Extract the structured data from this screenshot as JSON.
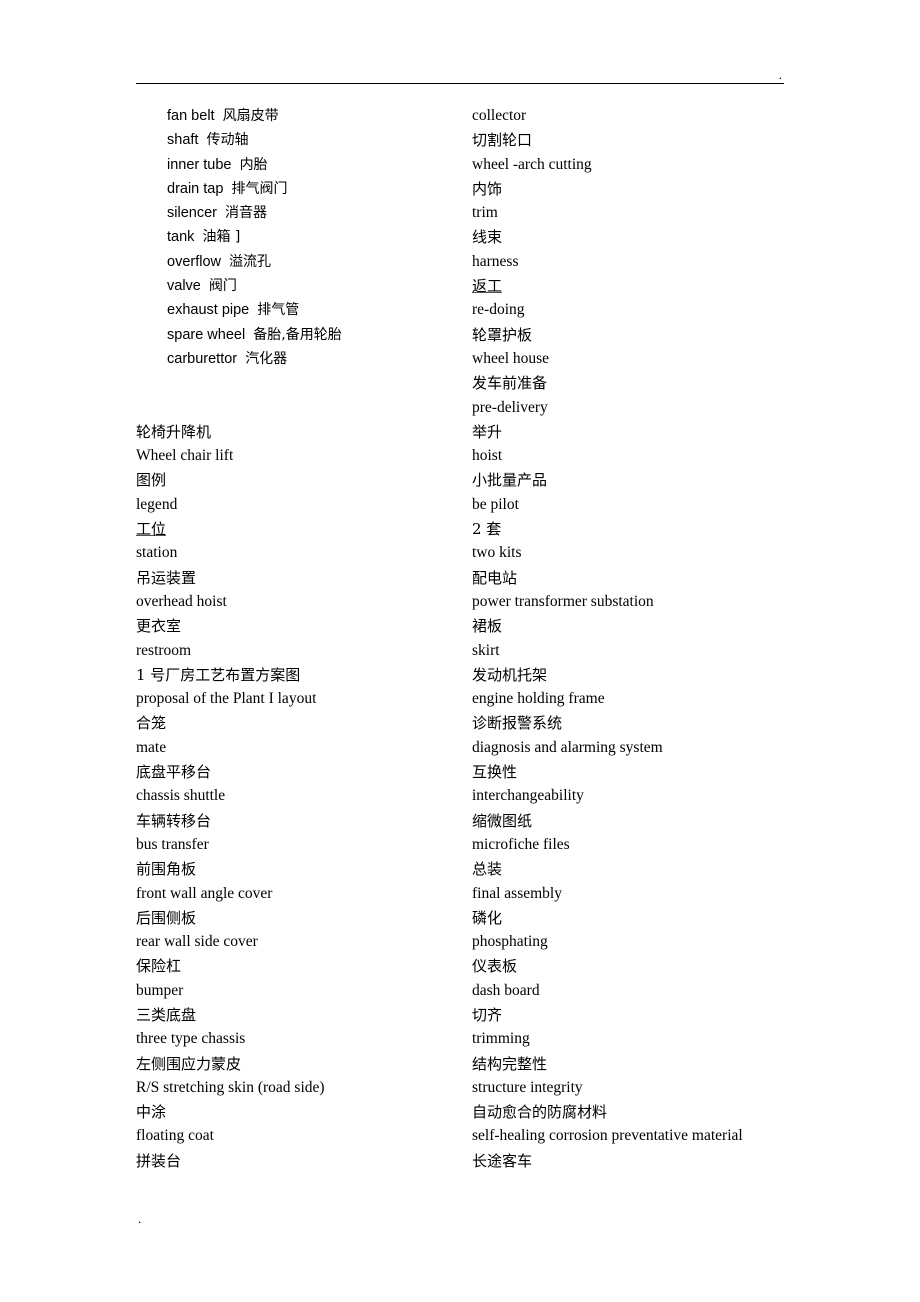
{
  "document": {
    "title": "Chinese-English Automotive Manufacturing Glossary",
    "header_rule_mark": ".",
    "footer_mark": "."
  },
  "left_column": {
    "intro_block": [
      {
        "en": "fan belt",
        "zh": "风扇皮带"
      },
      {
        "en": "shaft",
        "zh": "传动轴"
      },
      {
        "en": "inner tube",
        "zh": "内胎"
      },
      {
        "en": "drain tap",
        "zh": "排气阀门"
      },
      {
        "en": "silencer",
        "zh": "消音器"
      },
      {
        "en": "tank",
        "zh": "油箱  ]"
      },
      {
        "en": "overflow",
        "zh": "溢流孔"
      },
      {
        "en": "valve",
        "zh": "阀门"
      },
      {
        "en": "exhaust pipe",
        "zh": "排气管"
      },
      {
        "en": "spare wheel",
        "zh": "备胎,备用轮胎"
      },
      {
        "en": "carburettor",
        "zh": "汽化器"
      }
    ],
    "entries": [
      {
        "text": "轮椅升降机",
        "lang": "zh",
        "underline": false
      },
      {
        "text": "Wheel chair lift",
        "lang": "en",
        "underline": false
      },
      {
        "text": "图例",
        "lang": "zh",
        "underline": false
      },
      {
        "text": "legend",
        "lang": "en",
        "underline": false
      },
      {
        "text": "工位",
        "lang": "zh",
        "underline": true
      },
      {
        "text": "station",
        "lang": "en",
        "underline": false
      },
      {
        "text": "吊运装置",
        "lang": "zh",
        "underline": false
      },
      {
        "text": "overhead hoist",
        "lang": "en",
        "underline": false
      },
      {
        "text": "更衣室",
        "lang": "zh",
        "underline": false
      },
      {
        "text": "restroom",
        "lang": "en",
        "underline": false
      },
      {
        "text": "1 号厂房工艺布置方案图",
        "lang": "zh",
        "underline": false
      },
      {
        "text": "proposal of the Plant I layout",
        "lang": "en",
        "underline": false
      },
      {
        "text": "合笼",
        "lang": "zh",
        "underline": false
      },
      {
        "text": "mate",
        "lang": "en",
        "underline": false
      },
      {
        "text": "底盘平移台",
        "lang": "zh",
        "underline": false
      },
      {
        "text": "chassis shuttle",
        "lang": "en",
        "underline": false
      },
      {
        "text": "车辆转移台",
        "lang": "zh",
        "underline": false
      },
      {
        "text": "bus transfer",
        "lang": "en",
        "underline": false
      },
      {
        "text": "前围角板",
        "lang": "zh",
        "underline": false
      },
      {
        "text": "front wall angle cover",
        "lang": "en",
        "underline": false
      },
      {
        "text": "后围侧板",
        "lang": "zh",
        "underline": false
      },
      {
        "text": "rear wall side cover",
        "lang": "en",
        "underline": false
      },
      {
        "text": "保险杠",
        "lang": "zh",
        "underline": false
      },
      {
        "text": "bumper",
        "lang": "en",
        "underline": false
      },
      {
        "text": "三类底盘",
        "lang": "zh",
        "underline": false
      },
      {
        "text": "three type chassis",
        "lang": "en",
        "underline": false
      },
      {
        "text": "左侧围应力蒙皮",
        "lang": "zh",
        "underline": false
      },
      {
        "text": "R/S stretching skin (road side)",
        "lang": "en",
        "underline": false
      },
      {
        "text": "中涂",
        "lang": "zh",
        "underline": false
      },
      {
        "text": "floating coat",
        "lang": "en",
        "underline": false
      },
      {
        "text": "拼装台",
        "lang": "zh",
        "underline": false
      }
    ]
  },
  "right_column": {
    "entries": [
      {
        "text": "collector",
        "lang": "en",
        "underline": false
      },
      {
        "text": "切割轮口",
        "lang": "zh",
        "underline": false
      },
      {
        "text": "wheel -arch cutting",
        "lang": "en",
        "underline": false
      },
      {
        "text": "内饰",
        "lang": "zh",
        "underline": false
      },
      {
        "text": "trim",
        "lang": "en",
        "underline": false
      },
      {
        "text": "线束",
        "lang": "zh",
        "underline": false
      },
      {
        "text": "harness",
        "lang": "en",
        "underline": false
      },
      {
        "text": "返工",
        "lang": "zh",
        "underline": true
      },
      {
        "text": "re-doing",
        "lang": "en",
        "underline": false
      },
      {
        "text": "轮罩护板",
        "lang": "zh",
        "underline": false
      },
      {
        "text": "wheel house",
        "lang": "en",
        "underline": false
      },
      {
        "text": "发车前准备",
        "lang": "zh",
        "underline": false
      },
      {
        "text": "pre-delivery",
        "lang": "en",
        "underline": false
      },
      {
        "text": "举升",
        "lang": "zh",
        "underline": false
      },
      {
        "text": "hoist",
        "lang": "en",
        "underline": false
      },
      {
        "text": "小批量产品",
        "lang": "zh",
        "underline": false
      },
      {
        "text": "be pilot",
        "lang": "en",
        "underline": false
      },
      {
        "text": "2 套",
        "lang": "zh",
        "underline": false
      },
      {
        "text": "two kits",
        "lang": "en",
        "underline": false
      },
      {
        "text": "配电站",
        "lang": "zh",
        "underline": false
      },
      {
        "text": "power transformer substation",
        "lang": "en",
        "underline": false
      },
      {
        "text": "裙板",
        "lang": "zh",
        "underline": false
      },
      {
        "text": "skirt",
        "lang": "en",
        "underline": false
      },
      {
        "text": "发动机托架",
        "lang": "zh",
        "underline": false
      },
      {
        "text": "engine holding frame",
        "lang": "en",
        "underline": false
      },
      {
        "text": "诊断报警系统",
        "lang": "zh",
        "underline": false
      },
      {
        "text": "diagnosis and alarming system",
        "lang": "en",
        "underline": false
      },
      {
        "text": "互换性",
        "lang": "zh",
        "underline": false
      },
      {
        "text": "interchangeability",
        "lang": "en",
        "underline": false
      },
      {
        "text": "缩微图纸",
        "lang": "zh",
        "underline": false
      },
      {
        "text": "microfiche files",
        "lang": "en",
        "underline": false
      },
      {
        "text": "总装",
        "lang": "zh",
        "underline": false
      },
      {
        "text": "final assembly",
        "lang": "en",
        "underline": false
      },
      {
        "text": "磷化",
        "lang": "zh",
        "underline": false
      },
      {
        "text": "phosphating",
        "lang": "en",
        "underline": false
      },
      {
        "text": "仪表板",
        "lang": "zh",
        "underline": false
      },
      {
        "text": "dash board",
        "lang": "en",
        "underline": false
      },
      {
        "text": "切齐",
        "lang": "zh",
        "underline": false
      },
      {
        "text": "trimming",
        "lang": "en",
        "underline": false
      },
      {
        "text": "结构完整性",
        "lang": "zh",
        "underline": false
      },
      {
        "text": "structure integrity",
        "lang": "en",
        "underline": false
      },
      {
        "text": "自动愈合的防腐材料",
        "lang": "zh",
        "underline": false
      },
      {
        "text": "self-healing corrosion preventative material",
        "lang": "en",
        "underline": false
      },
      {
        "text": "长途客车",
        "lang": "zh",
        "underline": false
      }
    ]
  }
}
